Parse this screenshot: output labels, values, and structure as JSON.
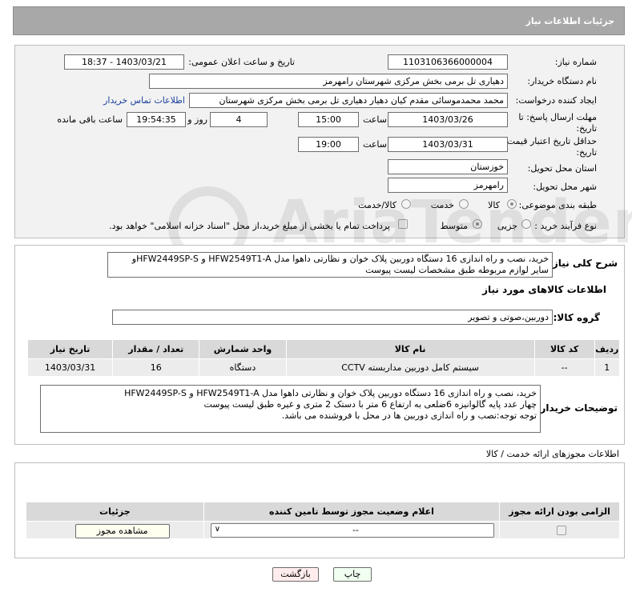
{
  "header": {
    "title": "جزئیات اطلاعات نیاز"
  },
  "form": {
    "need_number_label": "شماره نیاز:",
    "need_number": "1103106366000004",
    "announce_label": "تاریخ و ساعت اعلان عمومی:",
    "announce_value": "1403/03/21 - 18:37",
    "buyer_org_label": "نام دستگاه خریدار:",
    "buyer_org": "دهیاری تل برمی بخش مرکزی شهرستان رامهرمز",
    "requester_label": "ایجاد کننده درخواست:",
    "requester": "محمد محمدموسائی مقدم کیان دهیار دهیاری تل برمی بخش مرکزی شهرستان",
    "buyer_contact_link": "اطلاعات تماس خریدار",
    "deadline_label": "مهلت ارسال پاسخ: تا",
    "deadline_label2": "تاریخ:",
    "deadline_date": "1403/03/26",
    "time_label": "ساعت",
    "deadline_time": "15:00",
    "days_value": "4",
    "days_label": "روز و",
    "remaining_time": "19:54:35",
    "remaining_label": "ساعت باقی مانده",
    "validity_label": "حداقل تاریخ اعتبار قیمت: تا",
    "validity_label2": "تاریخ:",
    "validity_date": "1403/03/31",
    "validity_time_label": "ساعت",
    "validity_time": "19:00",
    "province_label": "استان محل تحویل:",
    "province": "خوزستان",
    "city_label": "شهر محل تحویل:",
    "city": "رامهرمز",
    "category_label": "طبقه بندی موضوعی:",
    "category_options": [
      "کالا",
      "خدمت",
      "کالا/خدمت"
    ],
    "purchase_type_label": "نوع فرآیند خرید :",
    "purchase_options": [
      "جزیی",
      "متوسط"
    ],
    "treasury_note": "پرداخت تمام یا بخشی از مبلغ خرید،از محل \"اسناد خزانه اسلامی\" خواهد بود."
  },
  "description": {
    "label": "شرح کلی نیاز:",
    "text_line1": "خرید، نصب و راه اندازی 16 دستگاه دوربین پلاک خوان و نظارتی داهوا مدل  HFW2549T1-A  و HFW2449SP-Sو",
    "text_line2": "سایر لوازم مربوطه طبق مشخصات لیست پیوست"
  },
  "goods": {
    "section_title": "اطلاعات کالاهای مورد نیاز",
    "group_label": "گروه کالا:",
    "group_value": "دوربین،صوتی و تصویر",
    "columns": [
      "ردیف",
      "کد کالا",
      "نام کالا",
      "واحد شمارش",
      "تعداد / مقدار",
      "تاریخ نیاز"
    ],
    "rows": [
      [
        "1",
        "--",
        "سیستم کامل دوربین مداربسته CCTV",
        "دستگاه",
        "16",
        "1403/03/31"
      ]
    ]
  },
  "buyer_notes": {
    "label": "توضیحات خریدار:",
    "line1": "خرید، نصب و راه اندازی 16 دستگاه دوربین پلاک خوان و نظارتی داهوا مدل  HFW2549T1-A  و HFW2449SP-S",
    "line2": "چهار عدد پایه گالوانیزه 6ضلعی به ارتفاع 6 متر با دستک 2 متری و غیره طبق لیست پیوست",
    "line3": "توجه توجه:نصب و راه اندازی دوربین ها در محل با فروشنده می باشد."
  },
  "permits": {
    "section_title": "اطلاعات مجوزهای ارائه خدمت / کالا",
    "columns": [
      "الزامی بودن ارائه مجوز",
      "اعلام وضعیت مجوز توسط تامین کننده",
      "جزئیات"
    ],
    "select_value": "--",
    "view_button": "مشاهده مجوز"
  },
  "actions": {
    "print": "چاپ",
    "back": "بازگشت"
  },
  "watermark": "AriaTender.neT"
}
